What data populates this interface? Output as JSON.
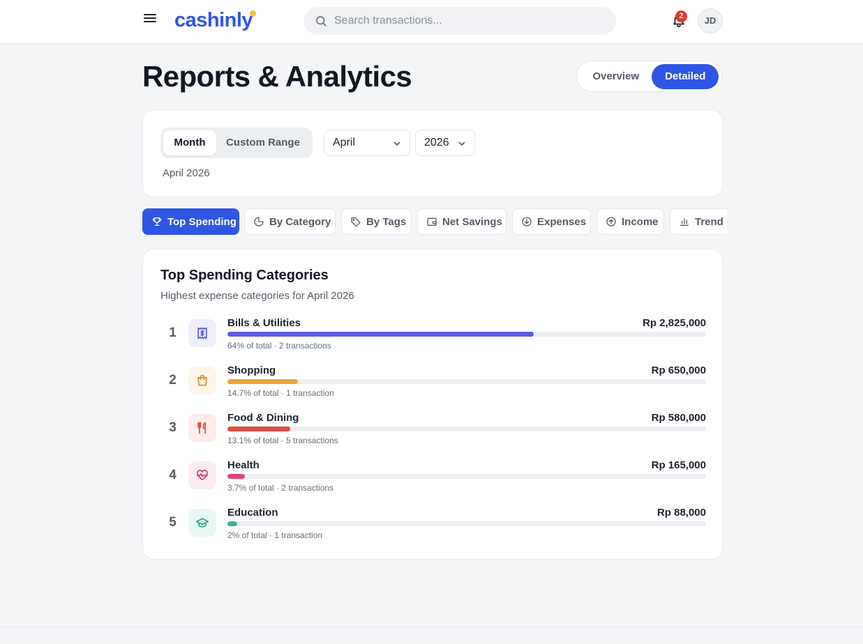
{
  "header": {
    "logo": "cashinly",
    "search_placeholder": "Search transactions...",
    "notification_count": "2",
    "avatar_initials": "JD"
  },
  "page": {
    "title": "Reports & Analytics",
    "view_toggle": {
      "overview": "Overview",
      "detailed": "Detailed",
      "selected": "Detailed"
    }
  },
  "filters": {
    "mode_month": "Month",
    "mode_custom": "Custom Range",
    "selected_mode": "Month",
    "month": "April",
    "year": "2026",
    "period_label": "April 2026"
  },
  "tabs": [
    {
      "label": "Top Spending",
      "icon": "trophy-icon",
      "active": true
    },
    {
      "label": "By Category",
      "icon": "pie-chart-icon",
      "active": false
    },
    {
      "label": "By Tags",
      "icon": "tag-icon",
      "active": false
    },
    {
      "label": "Net Savings",
      "icon": "wallet-icon",
      "active": false
    },
    {
      "label": "Expenses",
      "icon": "arrow-down-circle-icon",
      "active": false
    },
    {
      "label": "Income",
      "icon": "arrow-up-circle-icon",
      "active": false
    },
    {
      "label": "Trend",
      "icon": "bar-chart-icon",
      "active": false
    }
  ],
  "report": {
    "title": "Top Spending Categories",
    "subtitle": "Highest expense categories for April 2026",
    "items": [
      {
        "rank": "1",
        "name": "Bills & Utilities",
        "amount": "Rp 2,825,000",
        "percent": 64,
        "meta": "64% of total · 2 transactions",
        "icon": "receipt-icon",
        "color": "#5b5ce0",
        "icon_bg": "#eeeefc"
      },
      {
        "rank": "2",
        "name": "Shopping",
        "amount": "Rp 650,000",
        "percent": 14.7,
        "meta": "14.7% of total · 1 transaction",
        "icon": "shopping-bag-icon",
        "color": "#eaa338",
        "icon_bg": "#fdf5e8"
      },
      {
        "rank": "3",
        "name": "Food & Dining",
        "amount": "Rp 580,000",
        "percent": 13.1,
        "meta": "13.1% of total · 5 transactions",
        "icon": "utensils-icon",
        "color": "#df4a43",
        "icon_bg": "#fcecea"
      },
      {
        "rank": "4",
        "name": "Health",
        "amount": "Rp 165,000",
        "percent": 3.7,
        "meta": "3.7% of total · 2 transactions",
        "icon": "heart-pulse-icon",
        "color": "#e0457e",
        "icon_bg": "#fcebf1"
      },
      {
        "rank": "5",
        "name": "Education",
        "amount": "Rp 88,000",
        "percent": 2,
        "meta": "2% of total · 1 transaction",
        "icon": "graduation-cap-icon",
        "color": "#3bb39a",
        "icon_bg": "#e8f7f3"
      }
    ]
  }
}
